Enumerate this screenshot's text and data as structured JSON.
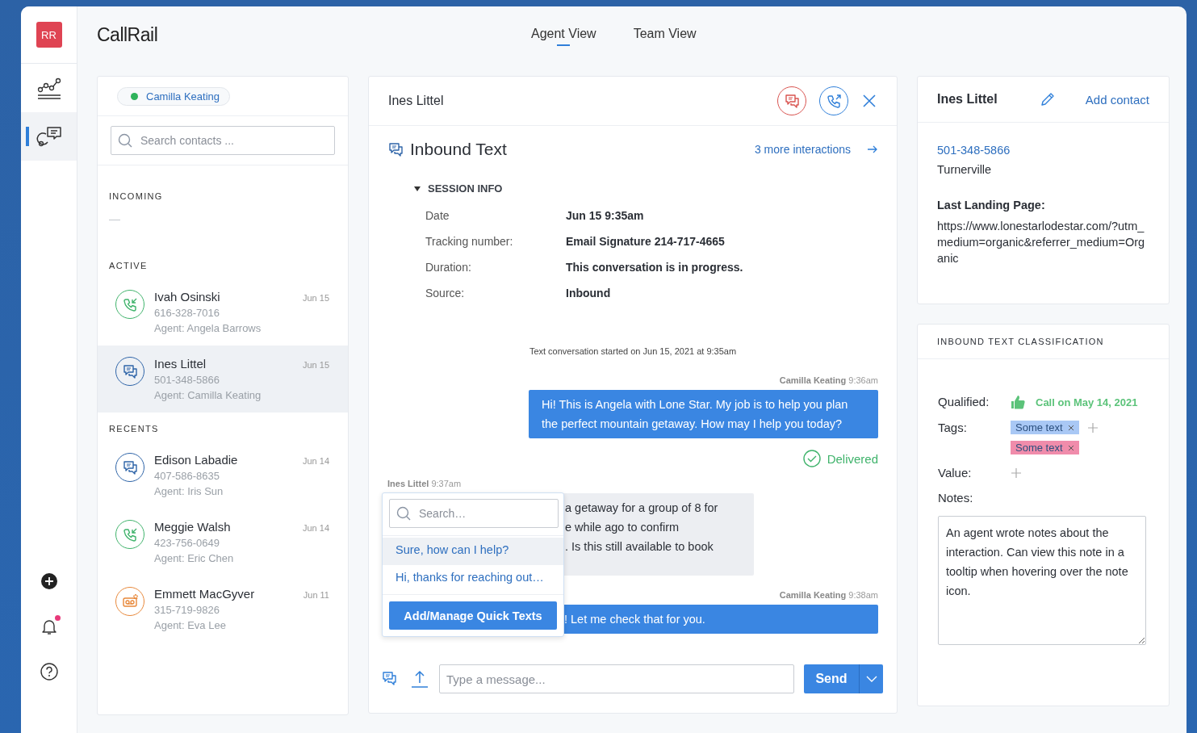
{
  "brand": {
    "avatar": "RR",
    "logo": "CallRail"
  },
  "rail": {
    "items": [
      {
        "kind": "chart",
        "selected": false
      },
      {
        "kind": "conversations",
        "selected": true
      }
    ],
    "bottom": [
      {
        "kind": "add",
        "badge": false
      },
      {
        "kind": "bell",
        "badge": true
      },
      {
        "kind": "help",
        "badge": false
      }
    ]
  },
  "tabs": [
    {
      "label": "Agent View",
      "selected": true
    },
    {
      "label": "Team View",
      "selected": false
    }
  ],
  "agent_status": {
    "name": "Camilla Keating",
    "online": true
  },
  "contact_search": {
    "placeholder": "Search contacts ..."
  },
  "sections": [
    {
      "title": "INCOMING",
      "empty": "—"
    },
    {
      "title": "ACTIVE",
      "contacts": [
        {
          "kind": "call",
          "name": "Ivah Osinski",
          "phone": "616-328-7016",
          "agent": "Agent: Angela Barrows",
          "date": "Jun 15",
          "selected": false
        },
        {
          "kind": "text",
          "name": "Ines Littel",
          "phone": "501-348-5866",
          "agent": "Agent: Camilla Keating",
          "date": "Jun 15",
          "selected": true
        }
      ]
    },
    {
      "title": "RECENTS",
      "contacts": [
        {
          "kind": "text",
          "name": "Edison Labadie",
          "phone": "407-586-8635",
          "agent": "Agent: Iris Sun",
          "date": "Jun 14",
          "selected": false
        },
        {
          "kind": "call",
          "name": "Meggie Walsh",
          "phone": "423-756-0649",
          "agent": "Agent: Eric Chen",
          "date": "Jun 14",
          "selected": false
        },
        {
          "kind": "voicemail",
          "name": "Emmett MacGyver",
          "phone": "315-719-9826",
          "agent": "Agent: Eva Lee",
          "date": "Jun 11",
          "selected": false
        }
      ]
    }
  ],
  "interaction": {
    "contact": "Ines Littel",
    "title": "Inbound Text",
    "more": "3 more interactions",
    "session_title": "SESSION INFO",
    "expanded": true,
    "fields": [
      {
        "label": "Date",
        "value": "Jun 15 9:35am"
      },
      {
        "label": "Tracking number:",
        "value": "Email Signature 214-717-4665"
      },
      {
        "label": "Duration:",
        "value": "This conversation is in progress."
      },
      {
        "label": "Source:",
        "value": "Inbound"
      }
    ]
  },
  "thread": [
    {
      "kind": "system",
      "text": "Text conversation started on Jun 15, 2021 at 9:35am"
    },
    {
      "kind": "outbound",
      "sender": "Camilla Keating",
      "time": "9:36am",
      "lines": [
        "Hi! This is Angela with Lone Star. My job is to help you plan",
        "the perfect mountain getaway. How may I help you today?"
      ]
    },
    {
      "kind": "status",
      "text": "Delivered"
    },
    {
      "kind": "inbound",
      "sender": "Ines Littel",
      "time": "9:37am",
      "lines": [
        "a getaway for a group of 8 for",
        "e while ago to confirm",
        ". Is this still available to book"
      ]
    },
    {
      "kind": "outbound",
      "sender": "Camilla Keating",
      "time": "9:38am",
      "lines": [
        "! Let me check that for you."
      ]
    }
  ],
  "quick_texts": {
    "placeholder": "Search…",
    "items": [
      {
        "text": "Sure, how can I help?",
        "selected": true
      },
      {
        "text": "Hi, thanks for reaching out…",
        "selected": false
      }
    ],
    "button": "Add/Manage Quick Texts"
  },
  "composer": {
    "placeholder": "Type a message...",
    "send": "Send"
  },
  "contact_card": {
    "name": "Ines Littel",
    "add": "Add contact",
    "phone": "501-348-5866",
    "city": "Turnerville",
    "landing_label": "Last Landing Page:",
    "landing_url": "https://www.lonestarlodestar.com/?utm_medium=organic&referrer_medium=Organic"
  },
  "classification": {
    "title": "INBOUND TEXT CLASSIFICATION",
    "qualified_label": "Qualified:",
    "qualified": true,
    "qualified_text": "Call on May 14, 2021",
    "tags_label": "Tags:",
    "tags": [
      {
        "text": "Some text",
        "color": "#a9c8f5"
      },
      {
        "text": "Some text",
        "color": "#f08cab"
      }
    ],
    "value_label": "Value:",
    "notes_label": "Notes:",
    "notes": "An agent wrote notes about the interaction. Can view this note in a tooltip when hovering over the note icon."
  }
}
